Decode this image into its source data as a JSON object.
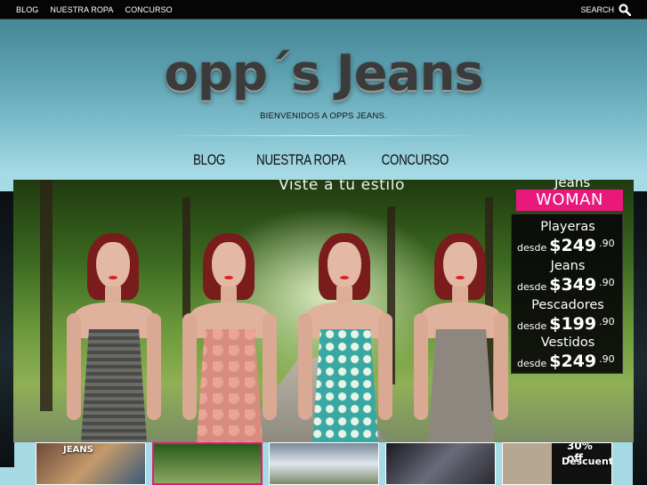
{
  "topbar": {
    "nav": [
      "BLOG",
      "NUESTRA ROPA",
      "CONCURSO"
    ],
    "search_label": "SEARCH",
    "search_icon": "search-icon"
  },
  "header": {
    "logo_text": "opp´s Jeans",
    "tagline": "BIENVENIDOS A OPPS JEANS."
  },
  "main_nav": [
    "BLOG",
    "NUESTRA ROPA",
    "CONCURSO"
  ],
  "banner": {
    "heading": "Viste a tu estilo",
    "brand_partial": "Jeans",
    "category": "WOMAN",
    "prices": [
      {
        "name": "Playeras",
        "desde": "desde",
        "price": "$249",
        "cents": ".90"
      },
      {
        "name": "Jeans",
        "desde": "desde",
        "price": "$349",
        "cents": ".90"
      },
      {
        "name": "Pescadores",
        "desde": "desde",
        "price": "$199",
        "cents": ".90"
      },
      {
        "name": "Vestidos",
        "desde": "desde",
        "price": "$249",
        "cents": ".90"
      }
    ]
  },
  "thumbnails": [
    {
      "label": "JEANS"
    },
    {
      "label": ""
    },
    {
      "label": ""
    },
    {
      "label": ""
    },
    {
      "label_top": "30% off",
      "label": "Descuento"
    }
  ],
  "colors": {
    "accent_pink": "#e8197b",
    "topbar_bg": "#050505"
  }
}
